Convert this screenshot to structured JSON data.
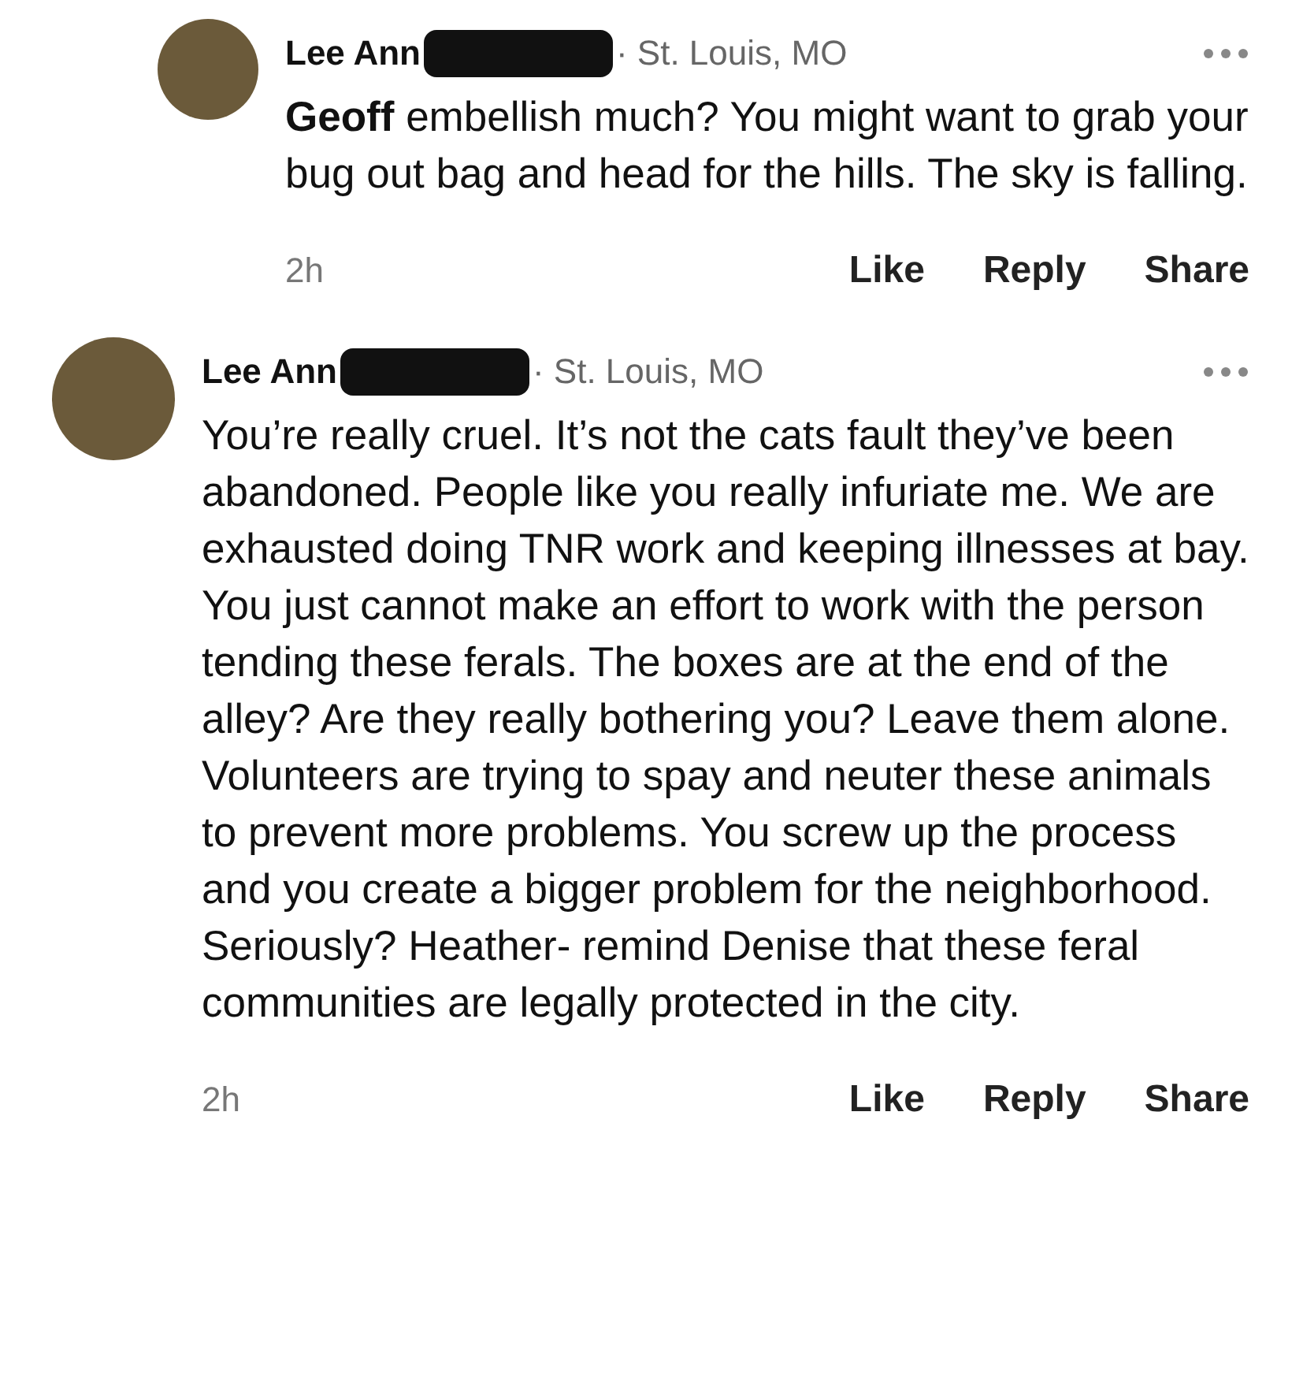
{
  "comments": [
    {
      "author": "Lee Ann",
      "author_redacted": true,
      "location": "· St. Louis, MO",
      "mention": "Geoff",
      "body": "embellish much? You might want to grab your bug out bag and head for the hills. The sky is falling.",
      "time": "2h",
      "actions": [
        "Like",
        "Reply",
        "Share"
      ],
      "nested": true
    },
    {
      "author": "Lee Ann",
      "author_redacted": true,
      "location": "· St. Louis, MO",
      "body": "You’re really cruel. It’s not the cats fault they’ve been abandoned. People like you really infuriate me. We are exhausted doing TNR work and keeping illnesses at bay. You just cannot make an effort to work with the person tending these ferals. The boxes are at the end of the alley? Are they really bothering you? Leave them alone. Volunteers are trying to spay and neuter these animals to prevent more problems. You screw up the process and you create a bigger problem for the neighborhood. Seriously? Heather- remind Denise that these feral communities are legally protected in the city.",
      "time": "2h",
      "actions": [
        "Like",
        "Reply",
        "Share"
      ],
      "nested": false
    }
  ]
}
